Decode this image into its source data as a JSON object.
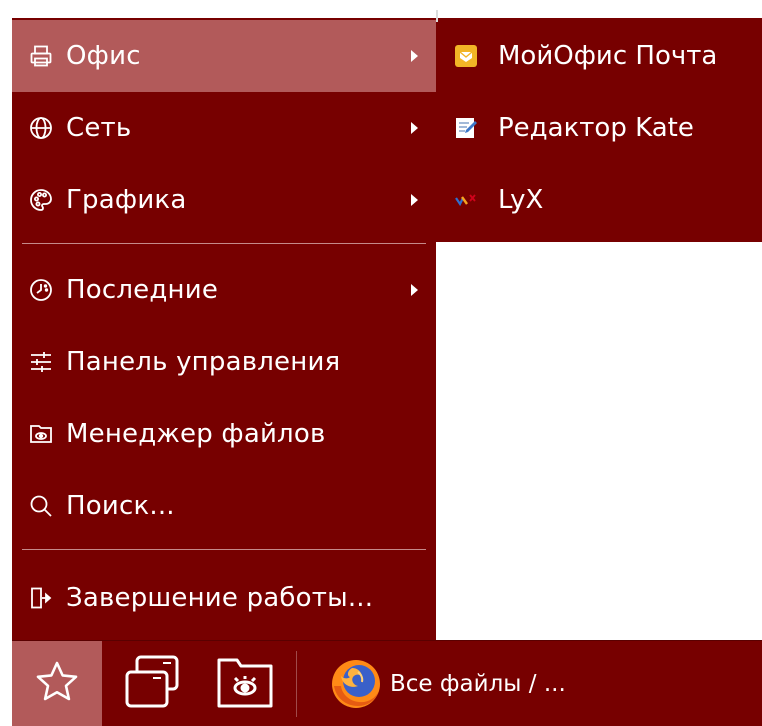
{
  "main_menu": {
    "items": [
      {
        "label": "Офис",
        "icon": "printer-icon",
        "has_submenu": true,
        "highlighted": true
      },
      {
        "label": "Сеть",
        "icon": "globe-icon",
        "has_submenu": true
      },
      {
        "label": "Графика",
        "icon": "palette-icon",
        "has_submenu": true
      },
      {
        "label": "Последние",
        "icon": "clock-icon",
        "has_submenu": true
      },
      {
        "label": "Панель управления",
        "icon": "sliders-icon",
        "has_submenu": false
      },
      {
        "label": "Менеджер файлов",
        "icon": "file-manager-icon",
        "has_submenu": false
      },
      {
        "label": "Поиск...",
        "icon": "search-icon",
        "has_submenu": false
      },
      {
        "label": "Завершение работы...",
        "icon": "logout-icon",
        "has_submenu": false
      }
    ]
  },
  "submenu": {
    "parent": "Офис",
    "items": [
      {
        "label": "МойОфис Почта",
        "icon": "myoffice-mail-icon"
      },
      {
        "label": "Редактор Kate",
        "icon": "kate-editor-icon"
      },
      {
        "label": "LyX",
        "icon": "lyx-icon"
      }
    ]
  },
  "taskbar": {
    "start_icon": "star-icon",
    "launchers": [
      {
        "icon": "windows-switcher-icon"
      },
      {
        "icon": "file-manager-folder-icon"
      }
    ],
    "window_task": {
      "icon": "firefox-icon",
      "title": "Все файлы / ..."
    }
  },
  "colors": {
    "menu_bg": "#770000",
    "highlight": "#b25a5a",
    "text": "#ffffff",
    "separator": "#c58a8a"
  }
}
